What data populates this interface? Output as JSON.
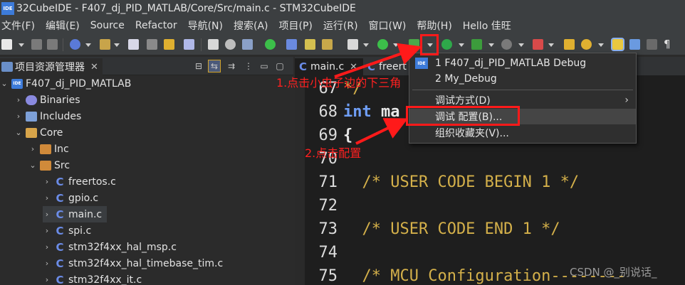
{
  "window": {
    "title": "32CubeIDE - F407_dj_PID_MATLAB/Core/Src/main.c - STM32CubeIDE",
    "logo_text": "IDE"
  },
  "menu": [
    "文件(F)",
    "编辑(E)",
    "Source",
    "Refactor",
    "导航(N)",
    "搜索(A)",
    "项目(P)",
    "运行(R)",
    "窗口(W)",
    "帮助(H)",
    "Hello 佳旺"
  ],
  "toolbar": {
    "icons": [
      "new-icon",
      "save-icon",
      "save-all-icon",
      "build-icon",
      "hammer-icon",
      "file-icon",
      "undo-icon",
      "redo-icon",
      "search-icon",
      "refresh-icon",
      "gear-icon",
      "chip-icon",
      "power-icon",
      "run-icon",
      "new-class-icon",
      "new-folder-icon",
      "task-icon",
      "debug-run-icon",
      "debug-bug-icon",
      "debug-dropdown-icon",
      "play-icon",
      "run-config-icon",
      "stop-icon",
      "marker-icon",
      "folder-open-icon",
      "search-icon",
      "highlight-icon",
      "wrap-icon",
      "block-icon",
      "pilcrow-icon"
    ]
  },
  "project_panel": {
    "tab_label": "项目资源管理器",
    "tree": [
      {
        "label": "F407_dj_PID_MATLAB",
        "icon": "project-icon",
        "level": 0,
        "expanded": true
      },
      {
        "label": "Binaries",
        "icon": "binaries-icon",
        "level": 1,
        "expanded": false
      },
      {
        "label": "Includes",
        "icon": "includes-icon",
        "level": 1,
        "expanded": false
      },
      {
        "label": "Core",
        "icon": "folder-icon",
        "level": 1,
        "expanded": true
      },
      {
        "label": "Inc",
        "icon": "folder-icon",
        "level": 2,
        "expanded": false
      },
      {
        "label": "Src",
        "icon": "folder-icon",
        "level": 2,
        "expanded": true
      },
      {
        "label": "freertos.c",
        "icon": "c-file-icon",
        "level": 3
      },
      {
        "label": "gpio.c",
        "icon": "c-file-icon",
        "level": 3
      },
      {
        "label": "main.c",
        "icon": "c-file-icon",
        "level": 3,
        "selected": true
      },
      {
        "label": "spi.c",
        "icon": "c-file-icon",
        "level": 3
      },
      {
        "label": "stm32f4xx_hal_msp.c",
        "icon": "c-file-icon",
        "level": 3
      },
      {
        "label": "stm32f4xx_hal_timebase_tim.c",
        "icon": "c-file-icon",
        "level": 3
      },
      {
        "label": "stm32f4xx_it.c",
        "icon": "c-file-icon",
        "level": 3
      }
    ]
  },
  "editor": {
    "tabs": [
      {
        "label": "main.c",
        "active": true
      },
      {
        "label": "freert"
      }
    ],
    "lines": [
      {
        "num": "67",
        "code": "*/",
        "style": "comment"
      },
      {
        "num": "68",
        "code_kw": "int",
        "code": " ma",
        "style": "plain"
      },
      {
        "num": "69",
        "code": "{",
        "style": "plain"
      },
      {
        "num": "70",
        "code": "",
        "style": "plain"
      },
      {
        "num": "71",
        "code": "  /* USER CODE BEGIN 1 */",
        "style": "comment"
      },
      {
        "num": "72",
        "code": "",
        "style": "plain"
      },
      {
        "num": "73",
        "code": "  /* USER CODE END 1 */",
        "style": "comment"
      },
      {
        "num": "74",
        "code": "",
        "style": "plain"
      },
      {
        "num": "75",
        "code": "  /* MCU Configuration--------",
        "style": "comment"
      }
    ]
  },
  "debug_menu": {
    "items": [
      {
        "label": "1 F407_dj_PID_MATLAB Debug",
        "icon": "ide-icon"
      },
      {
        "label": "2 My_Debug",
        "icon": ""
      },
      {
        "label": "调试方式(D)",
        "submenu": true
      },
      {
        "label": "调试 配置(B)...",
        "hover": true
      },
      {
        "label": "组织收藏夹(V)..."
      }
    ]
  },
  "annotations": {
    "step1": "1.点击小虫子边的下三角",
    "step2": "2.点击配置"
  },
  "watermark": "CSDN @_别说话_",
  "colors": {
    "accent": "#3d7bd9",
    "annotation": "#ff1a1a",
    "comment": "#d4b04a",
    "keyword": "#6f9ef5"
  }
}
